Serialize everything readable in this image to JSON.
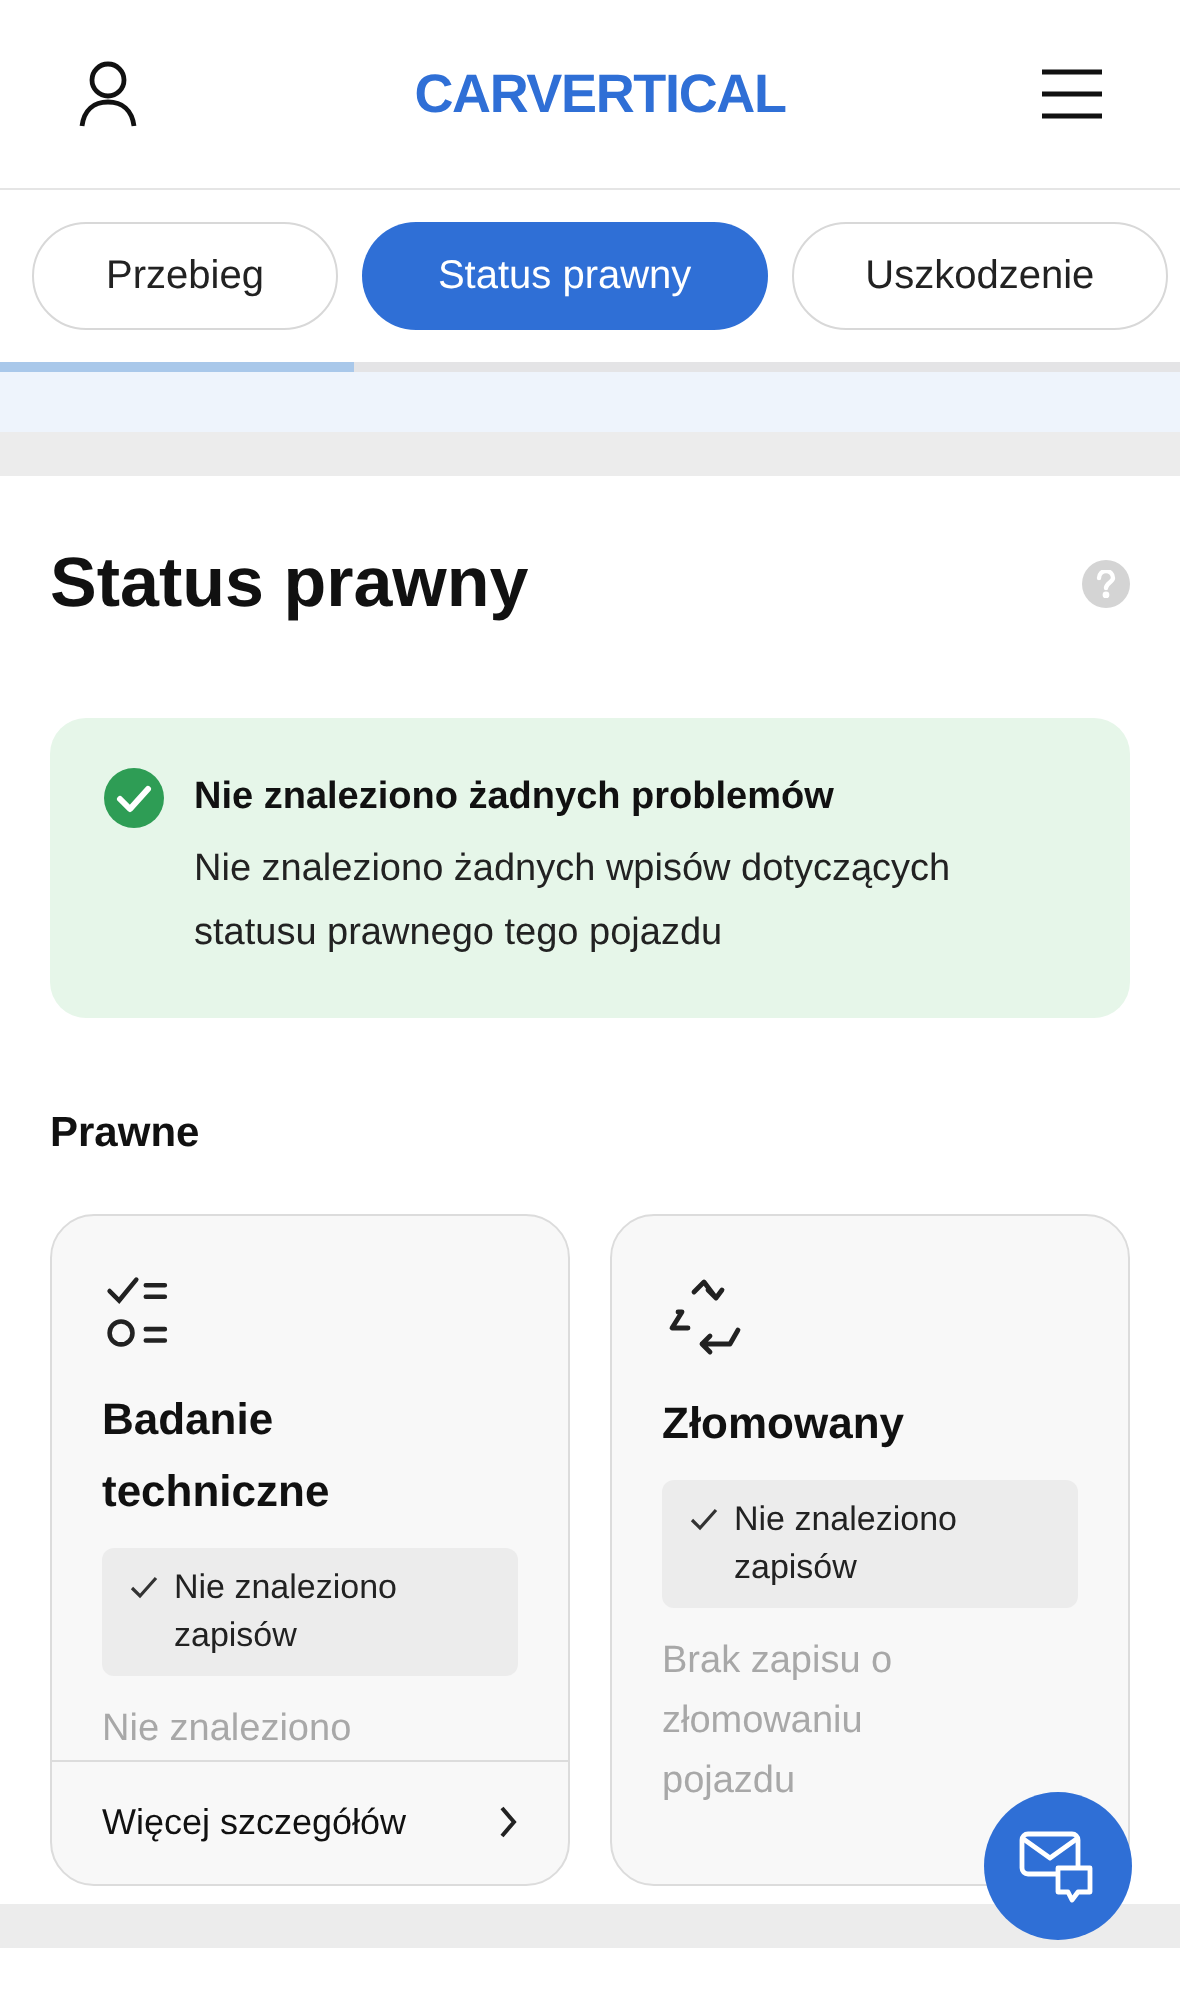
{
  "header": {
    "logo": "CARVERTICAL"
  },
  "tabs": [
    {
      "label": "Przebieg",
      "selected": false
    },
    {
      "label": "Status prawny",
      "selected": true
    },
    {
      "label": "Uszkodzenie",
      "selected": false
    }
  ],
  "progress": {
    "level": 0.3
  },
  "section": {
    "title": "Status prawny",
    "alert": {
      "title": "Nie znaleziono żadnych problemów",
      "text": "Nie znaleziono żadnych wpisów dotyczących statusu prawnego tego pojazdu"
    },
    "group_title": "Prawne",
    "cards": [
      {
        "kind": "checklist",
        "title": "Badanie techniczne",
        "status": "Nie znaleziono zapisów",
        "description": "Nie znaleziono",
        "link": "Więcej szczegółów"
      },
      {
        "kind": "recycle",
        "title": "Złomowany",
        "status": "Nie znaleziono zapisów",
        "description": "Brak zapisu o złomowaniu pojazdu"
      }
    ]
  }
}
